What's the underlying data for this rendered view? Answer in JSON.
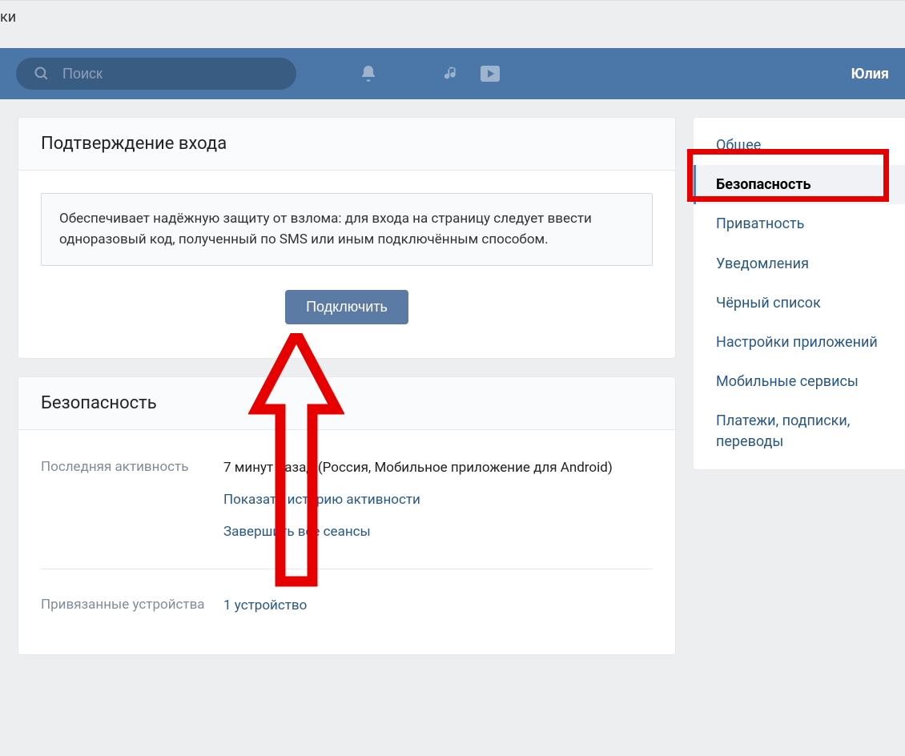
{
  "top_strip_text": "ки",
  "header": {
    "search_placeholder": "Поиск",
    "username": "Юлия"
  },
  "card_confirm": {
    "title": "Подтверждение входа",
    "info_text": "Обеспечивает надёжную защиту от взлома: для входа на страницу следует ввести одноразовый код, полученный по SMS или иным подключённым способом.",
    "connect_button": "Подключить"
  },
  "card_security": {
    "title": "Безопасность",
    "last_activity_label": "Последняя активность",
    "last_activity_value": "7 минут назад (Россия, Мобильное приложение для Android)",
    "show_history_link": "Показать историю активности",
    "end_sessions_link": "Завершить все сеансы",
    "devices_label": "Привязанные устройства",
    "devices_value": "1 устройство"
  },
  "sidebar": {
    "items": [
      {
        "label": "Общее"
      },
      {
        "label": "Безопасность"
      },
      {
        "label": "Приватность"
      },
      {
        "label": "Уведомления"
      },
      {
        "label": "Чёрный список"
      },
      {
        "label": "Настройки приложений"
      },
      {
        "label": "Мобильные сервисы"
      },
      {
        "label": "Платежи, подписки, переводы"
      }
    ]
  }
}
